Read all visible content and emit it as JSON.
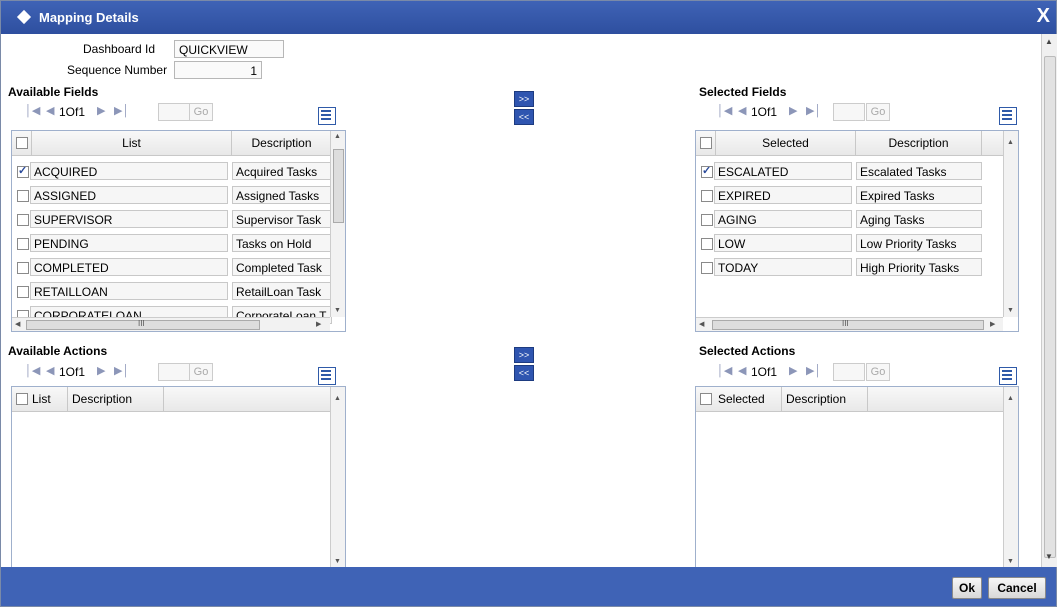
{
  "window": {
    "title": "Mapping Details",
    "close": "X"
  },
  "form": {
    "dashboard_id_label": "Dashboard Id",
    "dashboard_id_value": "QUICKVIEW",
    "sequence_label": "Sequence Number",
    "sequence_value": "1"
  },
  "available_fields": {
    "title": "Available Fields",
    "pager": {
      "text": "1Of1",
      "go": "Go"
    },
    "columns": [
      "List",
      "Description"
    ],
    "rows": [
      {
        "list": "ACQUIRED",
        "description": "Acquired Tasks",
        "checked": true
      },
      {
        "list": "ASSIGNED",
        "description": "Assigned Tasks",
        "checked": false
      },
      {
        "list": "SUPERVISOR",
        "description": "Supervisor Task",
        "checked": false
      },
      {
        "list": "PENDING",
        "description": "Tasks on Hold",
        "checked": false
      },
      {
        "list": "COMPLETED",
        "description": "Completed Task",
        "checked": false
      },
      {
        "list": "RETAILLOAN",
        "description": "RetailLoan Task",
        "checked": false
      },
      {
        "list": "CORPORATELOAN",
        "description": "CorporateLoan T",
        "checked": false
      }
    ]
  },
  "selected_fields": {
    "title": "Selected Fields",
    "pager": {
      "text": "1Of1",
      "go": "Go"
    },
    "columns": [
      "Selected",
      "Description"
    ],
    "rows": [
      {
        "selected": "ESCALATED",
        "description": "Escalated Tasks",
        "checked": true
      },
      {
        "selected": "EXPIRED",
        "description": "Expired Tasks",
        "checked": false
      },
      {
        "selected": "AGING",
        "description": "Aging Tasks",
        "checked": false
      },
      {
        "selected": "LOW",
        "description": "Low Priority Tasks",
        "checked": false
      },
      {
        "selected": "TODAY",
        "description": "High Priority Tasks",
        "checked": false
      }
    ]
  },
  "available_actions": {
    "title": "Available Actions",
    "pager": {
      "text": "1Of1",
      "go": "Go"
    },
    "columns": [
      "List",
      "Description"
    ]
  },
  "selected_actions": {
    "title": "Selected Actions",
    "pager": {
      "text": "1Of1",
      "go": "Go"
    },
    "columns": [
      "Selected",
      "Description"
    ]
  },
  "move": {
    "add": ">>",
    "remove": "<<"
  },
  "scroll_glyph": "III",
  "footer": {
    "ok": "Ok",
    "cancel": "Cancel"
  }
}
